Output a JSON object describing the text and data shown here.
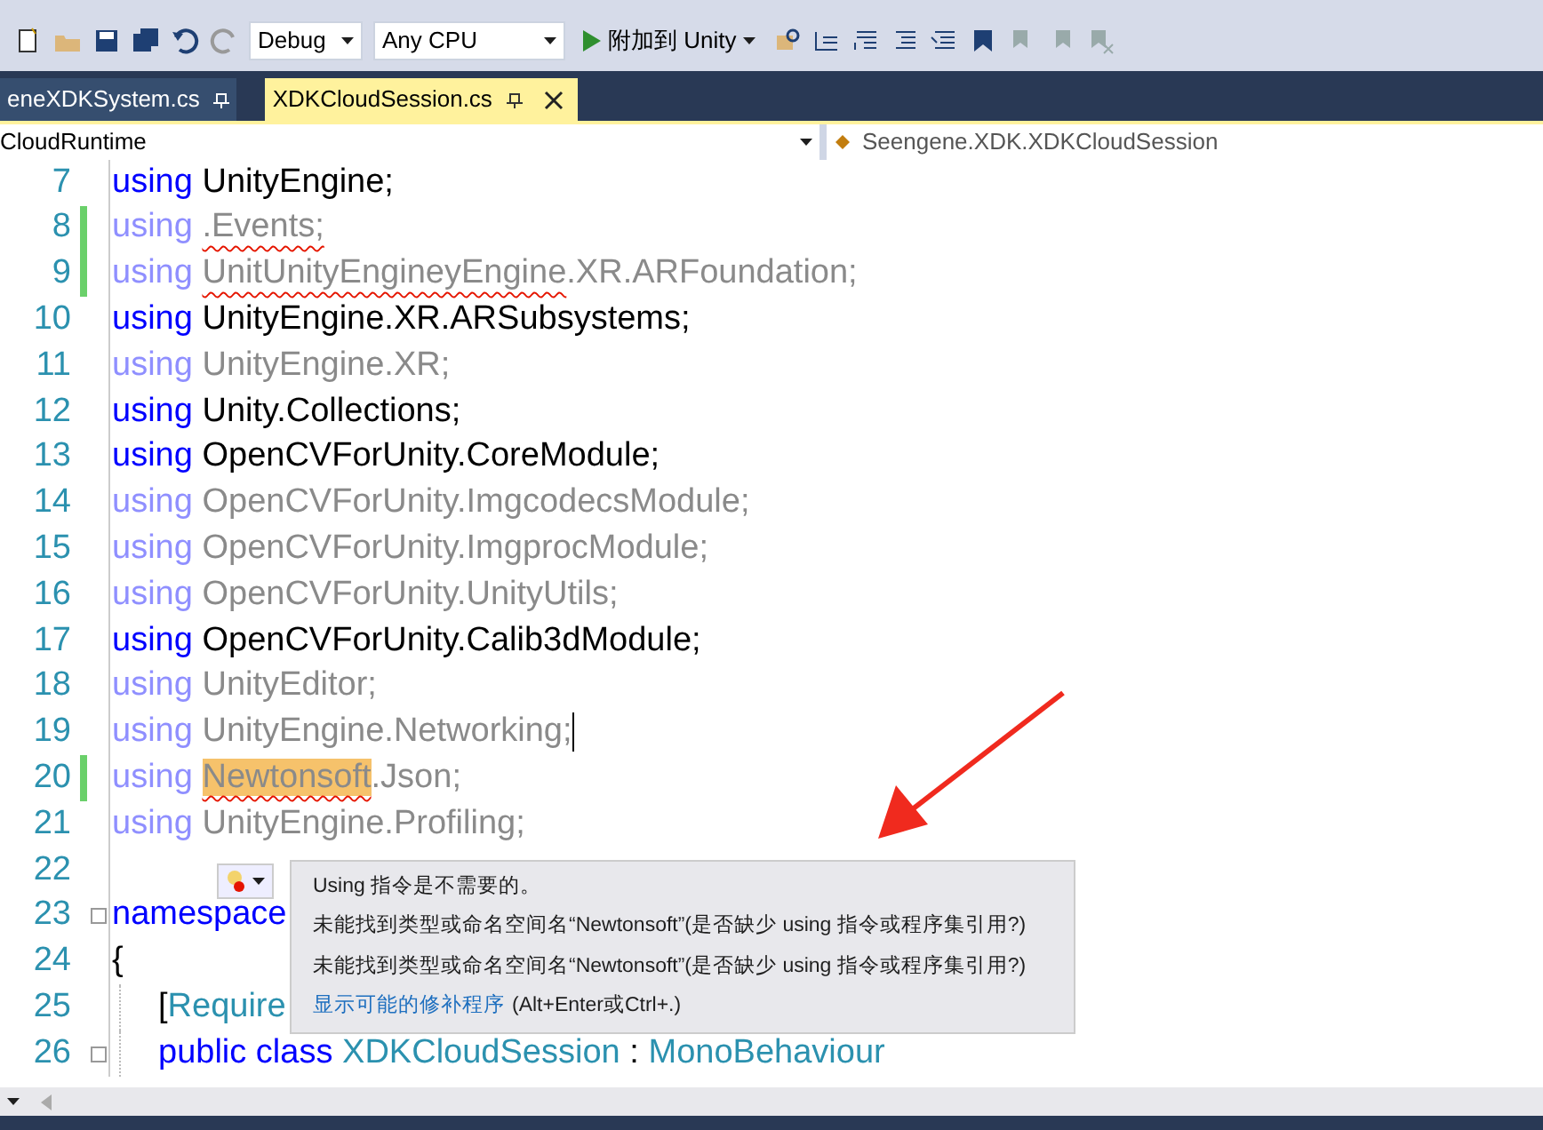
{
  "toolbar": {
    "configuration": "Debug",
    "platform": "Any CPU",
    "run_button": "附加到 Unity"
  },
  "tabs": [
    {
      "label": "eneXDKSystem.cs",
      "selected": false
    },
    {
      "label": "XDKCloudSession.cs",
      "selected": true
    }
  ],
  "nav_bar": {
    "project": "CloudRuntime",
    "type": "Seengene.XDK.XDKCloudSession"
  },
  "lines": [
    {
      "number": "7",
      "changed": false,
      "caret": false,
      "tokens": [
        {
          "text": "using",
          "kind": "keyword"
        },
        {
          "text": "UnityEngine;",
          "kind": "plain",
          "spaced": true
        }
      ]
    },
    {
      "number": "8",
      "changed": true,
      "caret": false,
      "tokens": [
        {
          "text": "using",
          "kind": "faded_keyword"
        },
        {
          "text": ".Events;",
          "kind": "faded_error",
          "spaced": true
        }
      ]
    },
    {
      "number": "9",
      "changed": true,
      "caret": false,
      "tokens": [
        {
          "text": "using",
          "kind": "faded_keyword"
        },
        {
          "text": "UnitUnityEngineyEngine",
          "kind": "faded_error",
          "spaced": true
        },
        {
          "text": ".XR.ARFoundation;",
          "kind": "faded"
        }
      ]
    },
    {
      "number": "10",
      "changed": false,
      "caret": false,
      "tokens": [
        {
          "text": "using",
          "kind": "keyword"
        },
        {
          "text": "UnityEngine.XR.ARSubsystems;",
          "kind": "plain",
          "spaced": true
        }
      ]
    },
    {
      "number": "11",
      "changed": false,
      "caret": false,
      "tokens": [
        {
          "text": "using",
          "kind": "faded_keyword"
        },
        {
          "text": "UnityEngine.XR;",
          "kind": "faded",
          "spaced": true
        }
      ]
    },
    {
      "number": "12",
      "changed": false,
      "caret": false,
      "tokens": [
        {
          "text": "using",
          "kind": "keyword"
        },
        {
          "text": "Unity.Collections;",
          "kind": "plain",
          "spaced": true
        }
      ]
    },
    {
      "number": "13",
      "changed": false,
      "caret": false,
      "tokens": [
        {
          "text": "using",
          "kind": "keyword"
        },
        {
          "text": "OpenCVForUnity.CoreModule;",
          "kind": "plain",
          "spaced": true
        }
      ]
    },
    {
      "number": "14",
      "changed": false,
      "caret": false,
      "tokens": [
        {
          "text": "using",
          "kind": "faded_keyword"
        },
        {
          "text": "OpenCVForUnity.ImgcodecsModule;",
          "kind": "faded",
          "spaced": true
        }
      ]
    },
    {
      "number": "15",
      "changed": false,
      "caret": false,
      "tokens": [
        {
          "text": "using",
          "kind": "faded_keyword"
        },
        {
          "text": "OpenCVForUnity.ImgprocModule;",
          "kind": "faded",
          "spaced": true
        }
      ]
    },
    {
      "number": "16",
      "changed": false,
      "caret": false,
      "tokens": [
        {
          "text": "using",
          "kind": "faded_keyword"
        },
        {
          "text": "OpenCVForUnity.UnityUtils;",
          "kind": "faded",
          "spaced": true
        }
      ]
    },
    {
      "number": "17",
      "changed": false,
      "caret": false,
      "tokens": [
        {
          "text": "using",
          "kind": "keyword"
        },
        {
          "text": "OpenCVForUnity.Calib3dModule;",
          "kind": "plain",
          "spaced": true
        }
      ]
    },
    {
      "number": "18",
      "changed": false,
      "caret": false,
      "tokens": [
        {
          "text": "using",
          "kind": "faded_keyword"
        },
        {
          "text": "UnityEditor;",
          "kind": "faded",
          "spaced": true
        }
      ]
    },
    {
      "number": "19",
      "changed": false,
      "caret": true,
      "tokens": [
        {
          "text": "using",
          "kind": "faded_keyword"
        },
        {
          "text": "UnityEngine.Networking;",
          "kind": "faded",
          "spaced": true
        }
      ]
    },
    {
      "number": "20",
      "changed": true,
      "caret": false,
      "tokens": [
        {
          "text": "using",
          "kind": "faded_keyword"
        },
        {
          "text": "Newtonsoft",
          "kind": "highlight",
          "spaced": true
        },
        {
          "text": ".Json;",
          "kind": "faded"
        }
      ]
    },
    {
      "number": "21",
      "changed": false,
      "caret": false,
      "tokens": [
        {
          "text": "using",
          "kind": "faded_keyword"
        },
        {
          "text": "UnityEngine.Profiling;",
          "kind": "faded",
          "spaced": true
        }
      ]
    },
    {
      "number": "22",
      "changed": false,
      "caret": false
    },
    {
      "number": "23",
      "changed": false,
      "caret": false,
      "fold": true,
      "tokens": [
        {
          "text": "namespace",
          "kind": "keyword"
        }
      ]
    },
    {
      "number": "24",
      "changed": false,
      "caret": false,
      "tokens": [
        {
          "text": "{",
          "kind": "plain"
        }
      ]
    },
    {
      "number": "25",
      "changed": false,
      "caret": false,
      "indent": true,
      "tokens": [
        {
          "text": "[",
          "kind": "plain"
        },
        {
          "text": "Require",
          "kind": "type"
        }
      ]
    },
    {
      "number": "26",
      "changed": false,
      "caret": false,
      "indent": true,
      "fold": true,
      "tokens": [
        {
          "text": "public class",
          "kind": "keyword"
        },
        {
          "text": "XDKCloudSession",
          "kind": "type",
          "spaced": true
        },
        {
          "text": ":",
          "kind": "plain",
          "spaced": true
        },
        {
          "text": "MonoBehaviour",
          "kind": "type",
          "spaced": true
        }
      ]
    }
  ],
  "quick_info": {
    "messages": [
      "Using 指令是不需要的。",
      "未能找到类型或命名空间名“Newtonsoft”(是否缺少 using 指令或程序集引用?)",
      "未能找到类型或命名空间名“Newtonsoft”(是否缺少 using 指令或程序集引用?)"
    ],
    "fix_link": "显示可能的修补程序",
    "fix_shortcut": "(Alt+Enter或Ctrl+.)"
  }
}
